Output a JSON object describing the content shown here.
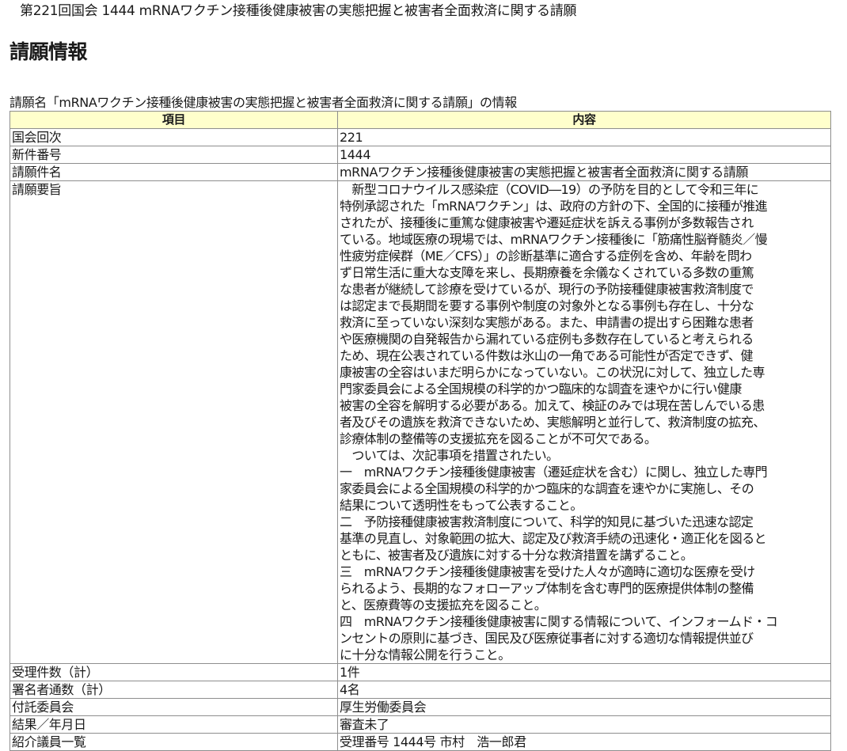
{
  "page": {
    "top_title": "第221回国会 1444 mRNAワクチン接種後健康被害の実態把握と被害者全面救済に関する請願",
    "heading": "請願情報",
    "caption": "請願名「mRNAワクチン接種後健康被害の実態把握と被害者全面救済に関する請願」の情報"
  },
  "table": {
    "headers": [
      "項目",
      "内容"
    ],
    "rows_before": [
      {
        "label": "国会回次",
        "value": "221"
      },
      {
        "label": "新件番号",
        "value": "1444"
      },
      {
        "label": "請願件名",
        "value": "mRNAワクチン接種後健康被害の実態把握と被害者全面救済に関する請願"
      }
    ],
    "summary_label": "請願要旨",
    "summary_lines": [
      "　新型コロナウイルス感染症（COVID―19）の予防を目的として令和三年に",
      "特例承認された「mRNAワクチン」は、政府の方針の下、全国的に接種が推進",
      "されたが、接種後に重篤な健康被害や遷延症状を訴える事例が多数報告され",
      "ている。地域医療の現場では、mRNAワクチン接種後に「筋痛性脳脊髄炎／慢",
      "性疲労症候群（ME／CFS）」の診断基準に適合する症例を含め、年齢を問わ",
      "ず日常生活に重大な支障を来し、長期療養を余儀なくされている多数の重篤",
      "な患者が継続して診療を受けているが、現行の予防接種健康被害救済制度で",
      "は認定まで長期間を要する事例や制度の対象外となる事例も存在し、十分な",
      "救済に至っていない深刻な実態がある。また、申請書の提出すら困難な患者",
      "や医療機関の自発報告から漏れている症例も多数存在していると考えられる",
      "ため、現在公表されている件数は氷山の一角である可能性が否定できず、健",
      "康被害の全容はいまだ明らかになっていない。この状況に対して、独立した専",
      "門家委員会による全国規模の科学的かつ臨床的な調査を速やかに行い健康",
      "被害の全容を解明する必要がある。加えて、検証のみでは現在苦しんでいる患",
      "者及びその遺族を救済できないため、実態解明と並行して、救済制度の拡充、",
      "診療体制の整備等の支援拡充を図ることが不可欠である。",
      "　ついては、次記事項を措置されたい。",
      "一　mRNAワクチン接種後健康被害（遷延症状を含む）に関し、独立した専門",
      "家委員会による全国規模の科学的かつ臨床的な調査を速やかに実施し、その",
      "結果について透明性をもって公表すること。",
      "二　予防接種健康被害救済制度について、科学的知見に基づいた迅速な認定",
      "基準の見直し、対象範囲の拡大、認定及び救済手続の迅速化・適正化を図ると",
      "ともに、被害者及び遺族に対する十分な救済措置を講ずること。",
      "三　mRNAワクチン接種後健康被害を受けた人々が適時に適切な医療を受け",
      "られるよう、長期的なフォローアップ体制を含む専門的医療提供体制の整備",
      "と、医療費等の支援拡充を図ること。",
      "四　mRNAワクチン接種後健康被害に関する情報について、インフォームド・コ",
      "ンセントの原則に基づき、国民及び医療従事者に対する適切な情報提供並び",
      "に十分な情報公開を行うこと。"
    ],
    "rows_after": [
      {
        "label": "受理件数（計）",
        "value": "1件"
      },
      {
        "label": "署名者通数（計）",
        "value": "4名"
      },
      {
        "label": "付託委員会",
        "value": "厚生労働委員会"
      },
      {
        "label": "結果／年月日",
        "value": "審査未了"
      },
      {
        "label": "紹介議員一覧",
        "value": "受理番号 1444号 市村　浩一郎君"
      }
    ]
  }
}
